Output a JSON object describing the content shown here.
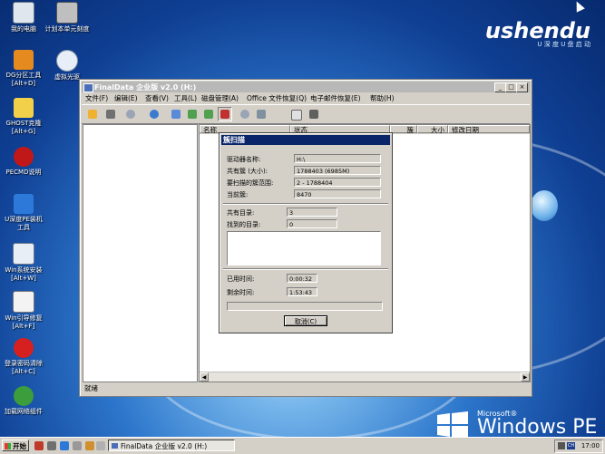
{
  "desktop": {
    "icons": [
      {
        "label": "我的电脑",
        "color": "#dfe6ee"
      },
      {
        "label": "计划本单元刻度",
        "color": "#bfbfbf"
      },
      {
        "label": "DG分区工具\n[Alt+D]",
        "color": "#e58a1f"
      },
      {
        "label": "虚拟光驱",
        "color": "#e7eef8"
      },
      {
        "label": "GHOST克隆\n[Alt+G]",
        "color": "#f2d04a"
      },
      {
        "label": "PECMD说明",
        "color": "#c01818"
      },
      {
        "label": "U深度PE装机\n工具",
        "color": "#2c79d9"
      },
      {
        "label": "Win系统安装\n[Alt+W]",
        "color": "#e8eef6"
      },
      {
        "label": "Win引导修复\n[Alt+F]",
        "color": "#f3f3f3"
      },
      {
        "label": "登录密码清除\n[Alt+C]",
        "color": "#d62020"
      },
      {
        "label": "加载网络组件",
        "color": "#3b9d3b"
      }
    ],
    "brand_name": "ushendu",
    "brand_sub": "U 深 度 U 盘 启 动",
    "winpe_microsoft": "Microsoft®",
    "winpe_label": "Windows PE"
  },
  "window": {
    "title": "FinalData 企业版 v2.0 (H:)",
    "controls": [
      "_",
      "□",
      "×"
    ],
    "menu": [
      "文件(F)",
      "编辑(E)",
      "查看(V)",
      "工具(L)",
      "磁盘管理(A)",
      "Office 文件恢复(Q)",
      "电子邮件恢复(E)",
      "帮助(H)"
    ],
    "toolbar_icons": [
      "open-folder-icon",
      "disk-icon",
      "search-icon",
      "gear-icon",
      "tree-icon",
      "tree-expand-icon",
      "tree-collapse-icon",
      "grid-icon",
      "find-icon",
      "find-list-icon",
      "copy-icon",
      "recover-icon"
    ],
    "columns": [
      "名称",
      "状态",
      "簇",
      "大小",
      "修改日期"
    ],
    "status": "就绪"
  },
  "dialog": {
    "title": "簇扫描",
    "fields": [
      {
        "label": "驱动器名称:",
        "value": "H:\\"
      },
      {
        "label": "共有簇 (大小):",
        "value": "1788403 (6985M)"
      },
      {
        "label": "要扫描的簇范围:",
        "value": "2 - 1788404"
      },
      {
        "label": "当前簇:",
        "value": "8470"
      }
    ],
    "dirs": [
      {
        "label": "共有目录:",
        "value": "3"
      },
      {
        "label": "找到的目录:",
        "value": "0"
      }
    ],
    "elapsed_label": "已用时间:",
    "elapsed_value": "0:00:32",
    "remaining_label": "剩余时间:",
    "remaining_value": "1:53:43",
    "progress": 0.0,
    "cancel_label": "取消(C)"
  },
  "taskbar": {
    "start_label": "开始",
    "task_label": "FinalData 企业版 v2.0 (H:)",
    "tray_ime": "CH",
    "clock": "17:00"
  }
}
